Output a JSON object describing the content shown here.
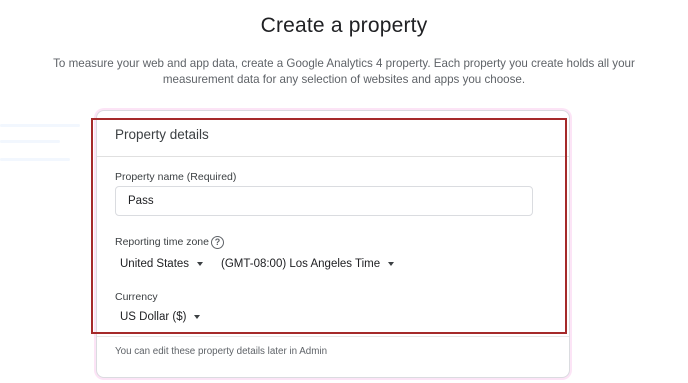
{
  "page": {
    "title": "Create a property",
    "description": "To measure your web and app data, create a Google Analytics 4 property. Each property you create holds all your measurement data for any selection of websites and apps you choose."
  },
  "card": {
    "title": "Property details",
    "property_name_label": "Property name (Required)",
    "property_name_value": "Pass",
    "timezone_label": "Reporting time zone",
    "help_icon_glyph": "?",
    "country_value": "United States",
    "timezone_value": "(GMT-08:00) Los Angeles Time",
    "currency_label": "Currency",
    "currency_value": "US Dollar ($)",
    "footer_note": "You can edit these property details later in Admin"
  },
  "colors": {
    "highlight_border": "#a52a2a",
    "card_border": "#dadce0"
  }
}
